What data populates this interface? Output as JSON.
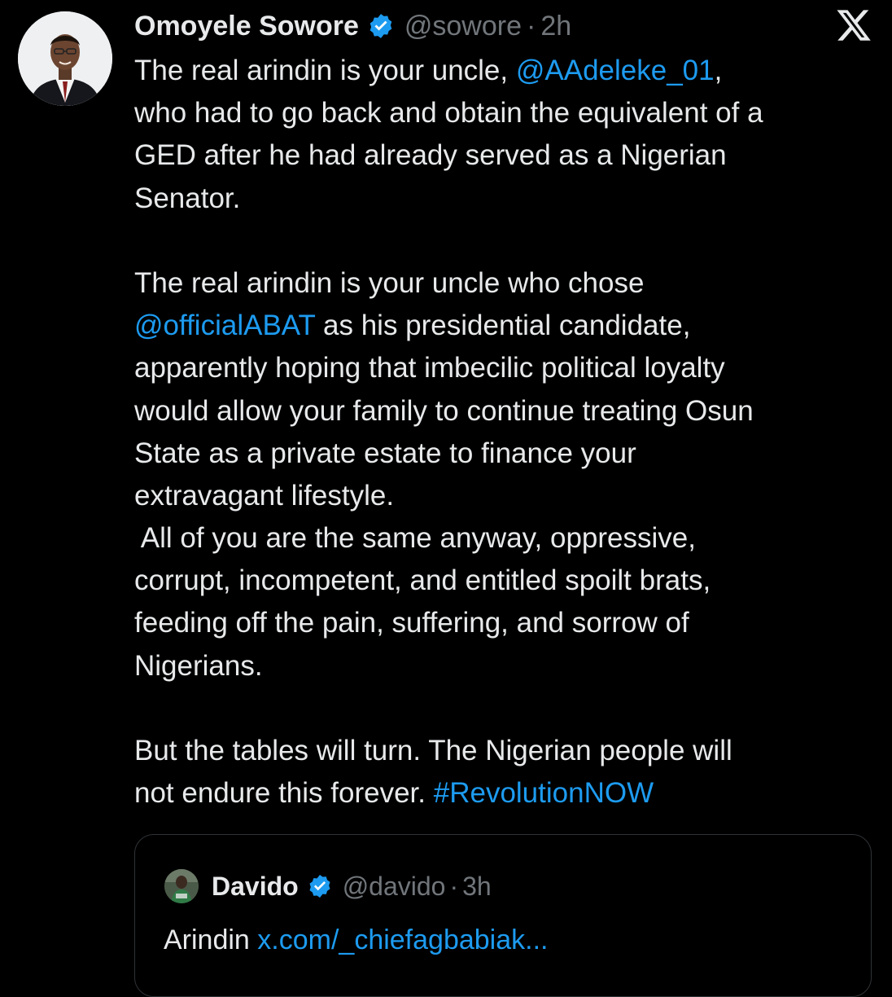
{
  "colors": {
    "background": "#000000",
    "text": "#e7e9ea",
    "secondary": "#71767b",
    "link": "#1d9bf0",
    "verified_badge": "#1d9bf0",
    "quote_border": "#2f3336"
  },
  "post": {
    "author": {
      "display_name": "Omoyele Sowore",
      "handle": "@sowore",
      "separator": "·",
      "time": "2h",
      "verified_icon": "verified-badge-icon",
      "avatar_icon": "profile-photo"
    },
    "platform_icon": "x-logo-icon",
    "lines": [
      [
        {
          "text": "The real arindin is your uncle, "
        },
        {
          "text": "@AAdeleke_01",
          "link": true
        },
        {
          "text": ","
        }
      ],
      [
        {
          "text": "who had to go back and obtain the equivalent of a"
        }
      ],
      [
        {
          "text": "GED after he had already served as a Nigerian"
        }
      ],
      [
        {
          "text": "Senator."
        }
      ],
      [
        {
          "text": ""
        }
      ],
      [
        {
          "text": "The real arindin is your uncle who chose"
        }
      ],
      [
        {
          "text": "@officialABAT",
          "link": true
        },
        {
          "text": " as his presidential candidate,"
        }
      ],
      [
        {
          "text": "apparently hoping that imbecilic political loyalty"
        }
      ],
      [
        {
          "text": "would allow your family to continue treating Osun"
        }
      ],
      [
        {
          "text": "State as a private estate to finance your"
        }
      ],
      [
        {
          "text": "extravagant lifestyle."
        }
      ],
      [
        {
          "text": " All of you are the same anyway, oppressive,"
        }
      ],
      [
        {
          "text": "corrupt, incompetent, and entitled spoilt brats,"
        }
      ],
      [
        {
          "text": "feeding off the pain, suffering, and sorrow of"
        }
      ],
      [
        {
          "text": "Nigerians."
        }
      ],
      [
        {
          "text": ""
        }
      ],
      [
        {
          "text": "But the tables will turn. The Nigerian people will"
        }
      ],
      [
        {
          "text": "not endure this forever. "
        },
        {
          "text": "#RevolutionNOW",
          "link": true
        }
      ]
    ]
  },
  "quoted_post": {
    "author": {
      "display_name": "Davido",
      "handle": "@davido",
      "separator": "·",
      "time": "3h",
      "verified_icon": "verified-badge-icon",
      "avatar_icon": "profile-photo"
    },
    "text": "Arindin ",
    "link_text": "x.com/_chiefagbabiak..."
  }
}
